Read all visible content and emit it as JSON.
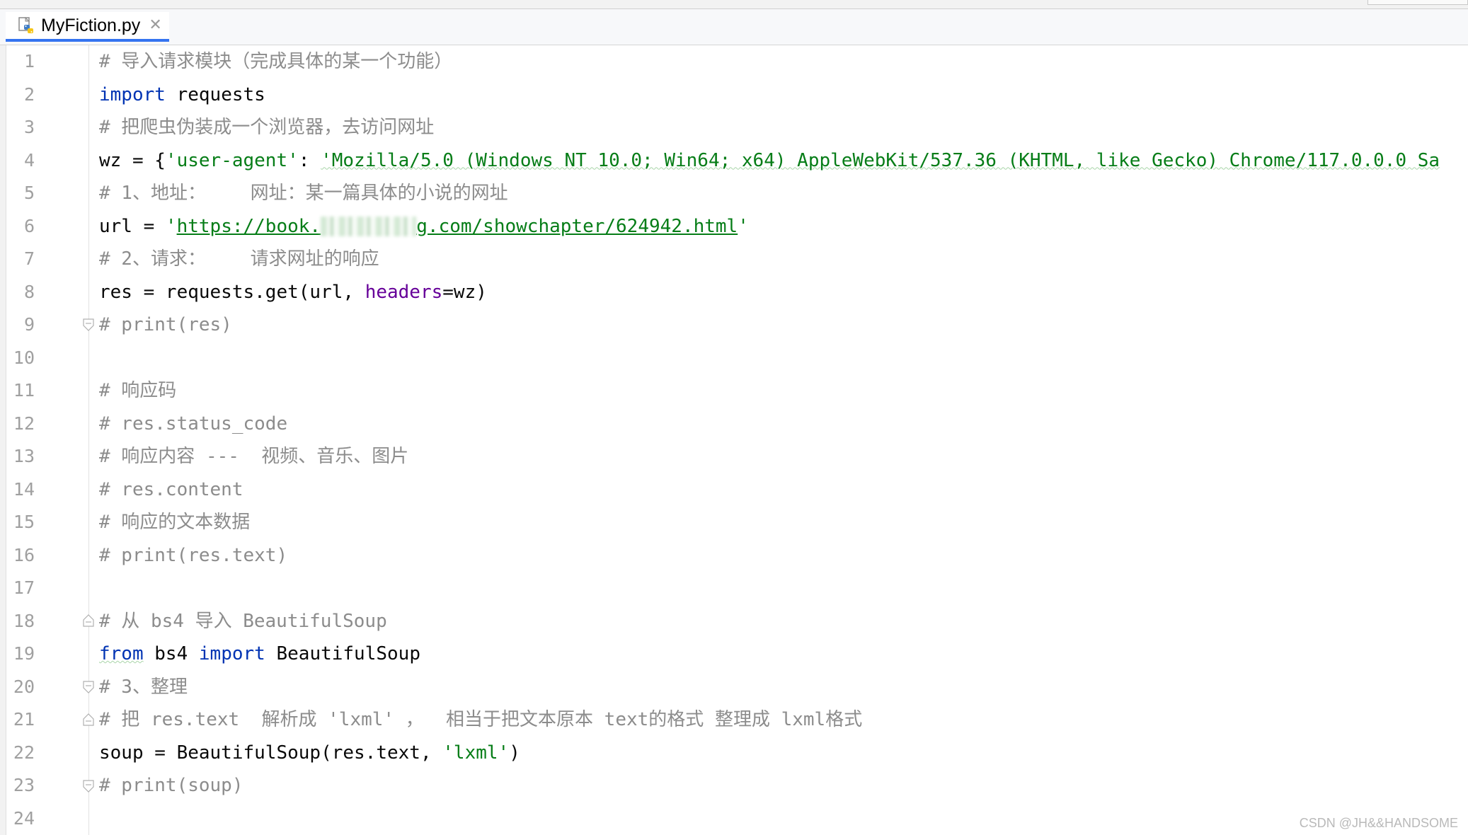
{
  "tab": {
    "filename": "MyFiction.py",
    "close_glyph": "✕",
    "accent_color": "#3574f0"
  },
  "line_numbers": [
    "1",
    "2",
    "3",
    "4",
    "5",
    "6",
    "7",
    "8",
    "9",
    "10",
    "11",
    "12",
    "13",
    "14",
    "15",
    "16",
    "17",
    "18",
    "19",
    "20",
    "21",
    "22",
    "23",
    "24"
  ],
  "code": {
    "l1_comment": "# 导入请求模块（完成具体的某一个功能）",
    "l2_kw": "import",
    "l2_rest": " requests",
    "l3_comment": "# 把爬虫伪装成一个浏览器，去访问网址",
    "l4_pre": "wz = {",
    "l4_key": "'user-agent'",
    "l4_mid": ": ",
    "l4_val": "'Mozilla/5.0 (Windows NT 10.0; Win64; x64) AppleWebKit/537.36 (KHTML, like Gecko) Chrome/117.0.0.0 Sa",
    "l5_comment": "# 1、地址：    网址：某一篇具体的小说的网址",
    "l6_pre": "url = ",
    "l6_q1": "'",
    "l6_url_a": "https://book.",
    "l6_url_b": "g.com/showchapter/624942.html",
    "l6_q2": "'",
    "l7_comment": "# 2、请求：    请求网址的响应",
    "l8_pre": "res = requests.get(url, ",
    "l8_named": "headers",
    "l8_post": "=wz)",
    "l9_comment": "# print(res)",
    "l11_comment": "# 响应码",
    "l12_comment": "# res.status_code",
    "l13_comment": "# 响应内容 ---  视频、音乐、图片",
    "l14_comment": "# res.content",
    "l15_comment": "# 响应的文本数据",
    "l16_comment": "# print(res.text)",
    "l18_comment": "# 从 bs4 导入 BeautifulSoup",
    "l19_kw1": "from",
    "l19_mid": " bs4 ",
    "l19_kw2": "import",
    "l19_rest": " BeautifulSoup",
    "l20_comment": "# 3、整理",
    "l21_comment": "# 把 res.text  解析成 'lxml' ，  相当于把文本原本 text的格式 整理成 lxml格式",
    "l22_pre": "soup = BeautifulSoup(res.text, ",
    "l22_str": "'lxml'",
    "l22_post": ")",
    "l23_comment": "# print(soup)"
  },
  "watermark": "CSDN @JH&&HANDSOME",
  "colors": {
    "keyword": "#0033b3",
    "string": "#067d17",
    "comment": "#8c8c8c",
    "named_arg": "#660099",
    "line_number": "#a0a0a0"
  }
}
